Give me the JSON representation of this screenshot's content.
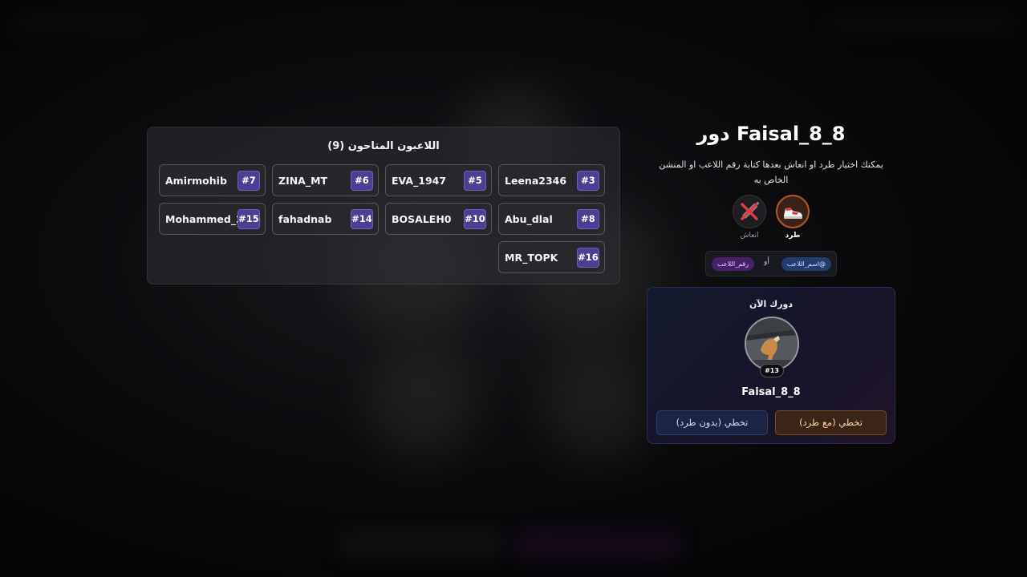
{
  "players": {
    "title": "اللاعبون المتاحون (9)",
    "list": [
      {
        "name": "Leena2346",
        "number": "#3"
      },
      {
        "name": "EVA_1947",
        "number": "#5"
      },
      {
        "name": "ZINA_MT",
        "number": "#6"
      },
      {
        "name": "Amirmohib",
        "number": "#7"
      },
      {
        "name": "Abu_dlal",
        "number": "#8"
      },
      {
        "name": "BOSALEH0",
        "number": "#10"
      },
      {
        "name": "fahadnab",
        "number": "#14"
      },
      {
        "name": "Mohammed_2...",
        "number": "#15"
      },
      {
        "name": "MR_TOPK",
        "number": "#16"
      }
    ]
  },
  "turn": {
    "title": "دور Faisal_8_8",
    "description": "يمكنك اختيار طرد او انعاش بعدها كتابة رقم اللاعب او المنشن الخاص به"
  },
  "actions": {
    "kick_label": "طرد",
    "revive_label": "انعاش",
    "kick_icon": "sneaker-kick-icon",
    "revive_icon": "syringe-cross-icon"
  },
  "mention_hint": {
    "name_chip": "@اسم_اللاعب",
    "or": "أو",
    "number_chip": "رقم_اللاعب"
  },
  "current": {
    "label": "دورك الآن",
    "player_number": "#13",
    "player_name": "Faisal_8_8",
    "skip_with_kick": "تخطي (مع طرد)",
    "skip_without_kick": "تخطي (بدون طرد)"
  },
  "colors": {
    "background": "#050507",
    "number_badge": "#4b3f93",
    "kick_accent": "#b55a22",
    "skip_blue": "#1c2444"
  }
}
